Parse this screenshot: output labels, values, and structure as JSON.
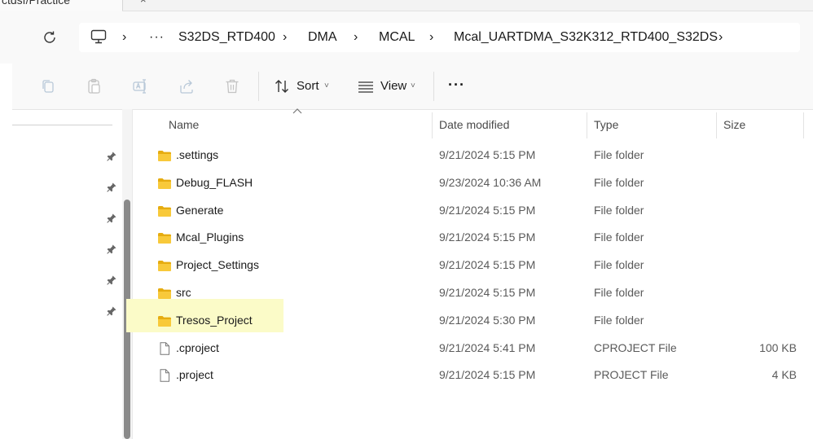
{
  "tab": {
    "title": "ctdsf/Practice",
    "close_glyph": "×"
  },
  "address": {
    "overflow_glyph": "···",
    "crumbs": [
      "S32DS_RTD400",
      "DMA",
      "MCAL",
      "Mcal_UARTDMA_S32K312_RTD400_S32DS"
    ],
    "separator": "›"
  },
  "toolbar": {
    "sort_label": "Sort",
    "view_label": "View",
    "more_label": "···",
    "dropdown_glyph": "˅"
  },
  "columns": {
    "name": "Name",
    "date": "Date modified",
    "type": "Type",
    "size": "Size"
  },
  "files": [
    {
      "name": ".settings",
      "date": "9/21/2024 5:15 PM",
      "type": "File folder",
      "size": "",
      "kind": "folder"
    },
    {
      "name": "Debug_FLASH",
      "date": "9/23/2024 10:36 AM",
      "type": "File folder",
      "size": "",
      "kind": "folder"
    },
    {
      "name": "Generate",
      "date": "9/21/2024 5:15 PM",
      "type": "File folder",
      "size": "",
      "kind": "folder"
    },
    {
      "name": "Mcal_Plugins",
      "date": "9/21/2024 5:15 PM",
      "type": "File folder",
      "size": "",
      "kind": "folder"
    },
    {
      "name": "Project_Settings",
      "date": "9/21/2024 5:15 PM",
      "type": "File folder",
      "size": "",
      "kind": "folder"
    },
    {
      "name": "src",
      "date": "9/21/2024 5:15 PM",
      "type": "File folder",
      "size": "",
      "kind": "folder"
    },
    {
      "name": "Tresos_Project",
      "date": "9/21/2024 5:30 PM",
      "type": "File folder",
      "size": "",
      "kind": "folder",
      "highlighted": true
    },
    {
      "name": ".cproject",
      "date": "9/21/2024 5:41 PM",
      "type": "CPROJECT File",
      "size": "100 KB",
      "kind": "file"
    },
    {
      "name": ".project",
      "date": "9/21/2024 5:15 PM",
      "type": "PROJECT File",
      "size": "4 KB",
      "kind": "file"
    }
  ],
  "colors": {
    "highlight": "#fbfbc8",
    "folder": "#f8c93a",
    "folder_dark": "#e6ac10"
  }
}
